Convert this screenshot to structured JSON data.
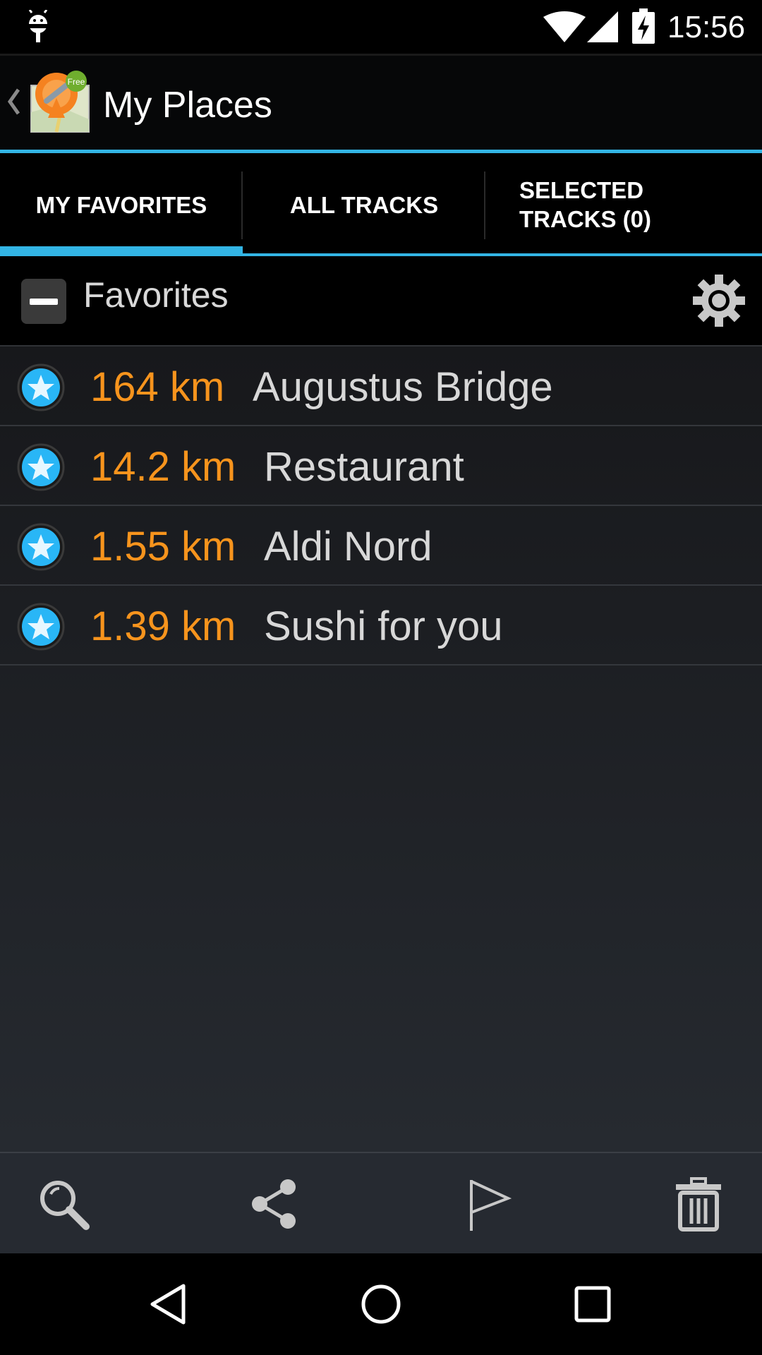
{
  "status_bar": {
    "time": "15:56"
  },
  "action_bar": {
    "title": "My Places",
    "app_badge": "Free"
  },
  "tabs": [
    {
      "label": "MY FAVORITES",
      "active": true
    },
    {
      "label": "ALL TRACKS",
      "active": false
    },
    {
      "label": "SELECTED TRACKS (0)",
      "active": false
    }
  ],
  "group": {
    "title": "Favorites"
  },
  "favorites": [
    {
      "distance": "164 km",
      "name": "Augustus Bridge"
    },
    {
      "distance": "14.2 km",
      "name": "Restaurant"
    },
    {
      "distance": "1.55 km",
      "name": "Aldi Nord"
    },
    {
      "distance": "1.39 km",
      "name": "Sushi for you"
    }
  ],
  "bottom_actions": [
    "search-icon",
    "share-icon",
    "flag-icon",
    "trash-icon"
  ],
  "nav_buttons": [
    "back-icon",
    "home-icon",
    "recents-icon"
  ],
  "colors": {
    "accent": "#33b5e5",
    "distance": "#f7941d"
  }
}
